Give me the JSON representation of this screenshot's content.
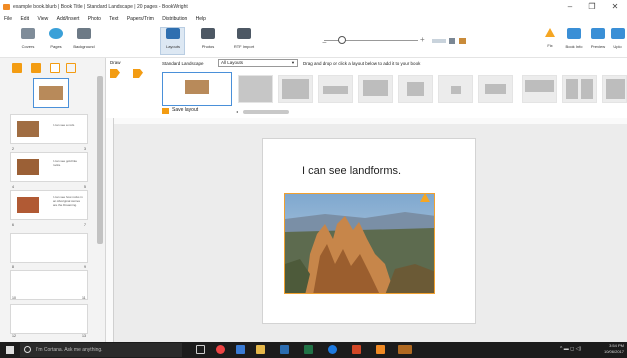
{
  "window": {
    "title": "example book.blurb | Book Title | Standard Landscape | 20 pages - BookWright",
    "minimize": "–",
    "maximize": "❐",
    "close": "✕"
  },
  "menu": [
    "File",
    "Edit",
    "View",
    "Add/Insert",
    "Photo",
    "Text",
    "Papers/Trim",
    "Distribution",
    "Help"
  ],
  "ribbon": {
    "covers": "Covers",
    "pages": "Pages",
    "background": "Background",
    "layouts": "Layouts",
    "photos": "Photos",
    "rtf_import": "RTF Import",
    "fix": "Fix",
    "book_info": "Book Info",
    "preview": "Preview",
    "upload": "Uplo"
  },
  "sidebar": {
    "draw_label": "Draw",
    "pages": [
      {
        "left": "2",
        "right": "3",
        "caption": "I can see a rock."
      },
      {
        "left": "4",
        "right": "5",
        "caption": "I can see gold like rocks."
      },
      {
        "left": "6",
        "right": "7",
        "caption": "I can see how rocks in an Aboriginal stories are the Dreaming."
      },
      {
        "left": "8",
        "right": "9",
        "caption": ""
      },
      {
        "left": "10",
        "right": "11",
        "caption": ""
      },
      {
        "left": "12",
        "right": "13",
        "caption": ""
      }
    ]
  },
  "layout_bar": {
    "size_label": "Standard Landscape",
    "filter_value": "All Layouts",
    "instructions": "Drag and drop or click a layout below to add it to your book",
    "save_layout": "Save layout"
  },
  "page_content": {
    "text": "I can see landforms."
  },
  "taskbar": {
    "cortana": "I'm Cortana. Ask me anything.",
    "time": "3:54 PM",
    "date": "10/06/2017"
  },
  "colors": {
    "accent": "#f39c12",
    "warning": "#f5a623",
    "selection": "#4a90d9"
  }
}
